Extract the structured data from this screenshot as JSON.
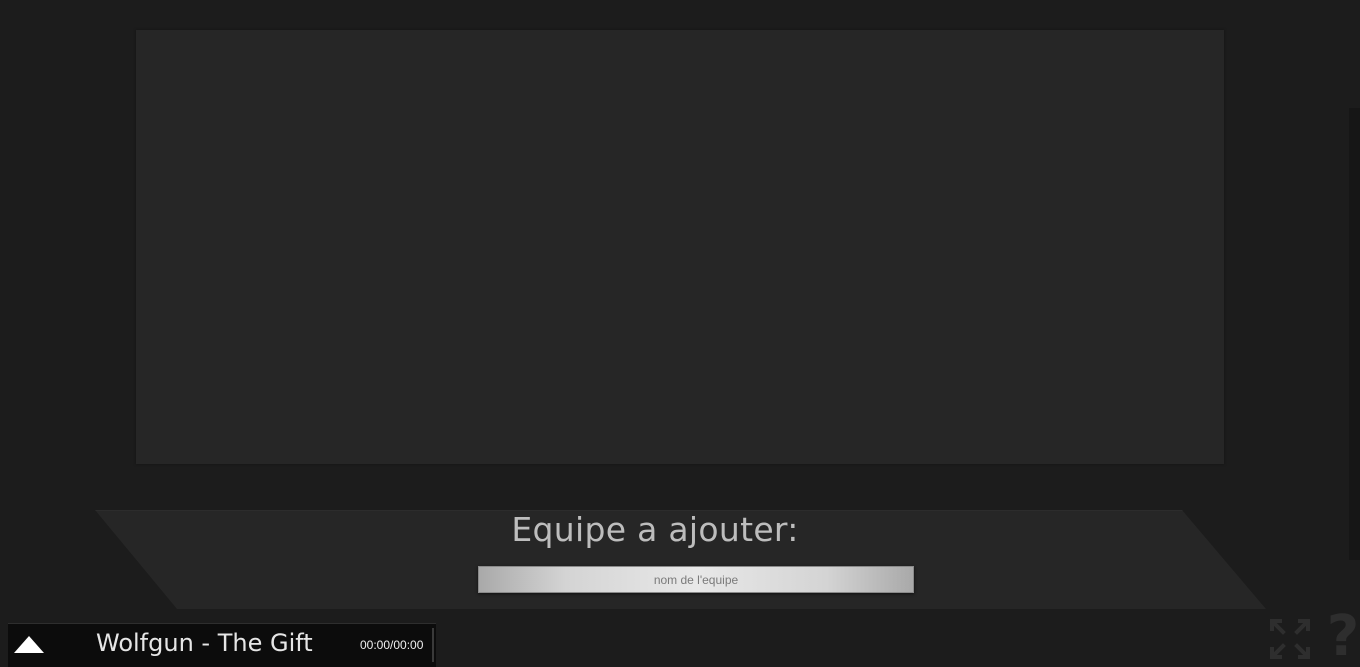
{
  "add_team": {
    "title": "Equipe a ajouter:",
    "input_value": "",
    "input_placeholder": "nom de l'equipe"
  },
  "player": {
    "toggle_icon": "triangle-up-icon",
    "track_title": "Wolfgun - The Gift",
    "time": "00:00/00:00"
  },
  "controls": {
    "fullscreen_icon": "fullscreen-icon",
    "help_icon": "help-icon",
    "help_glyph": "?"
  },
  "colors": {
    "background": "#1c1c1c",
    "panel": "#262626",
    "player_bar": "#0c0c0c"
  }
}
